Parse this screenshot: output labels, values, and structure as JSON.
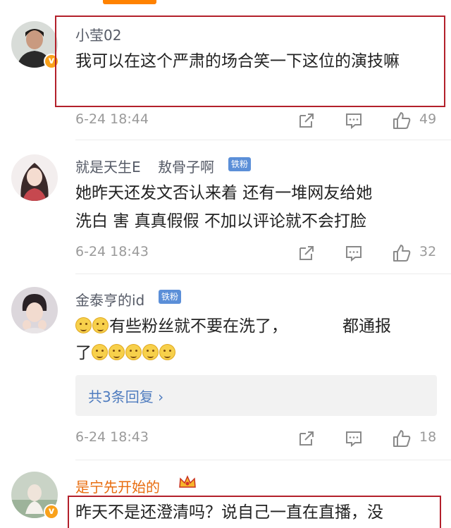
{
  "colors": {
    "accent": "#ff8200",
    "highlight_border": "#b3202b",
    "fan_badge": "#5b8fd8",
    "link": "#4f7cbf",
    "gold_name": "#e86c0e"
  },
  "comments": [
    {
      "username": "小莹02",
      "text": "我可以在这个严肃的场合笑一下这位的演技嘛",
      "time": "6-24 18:44",
      "likes": "49",
      "verified": true
    },
    {
      "username": "就是天生E",
      "username_tail": "敖骨子啊",
      "badge": "铁粉",
      "line1": "她昨天还发文否认来着 还有一堆网友给她",
      "line2": "洗白 害  真真假假 不加以评论就不会打脸",
      "time": "6-24 18:43",
      "likes": "32"
    },
    {
      "username": "金泰亨的id",
      "badge": "铁粉",
      "line1_text": "有些粉丝就不要在洗了，",
      "line1_tail": "都通报",
      "line2_text": "了",
      "replies": "共3条回复 ›",
      "time": "6-24 18:43",
      "likes": "18"
    },
    {
      "username": "是宁先开始的",
      "text": "昨天不是还澄清吗？说自己一直在直播，没",
      "verified": true
    }
  ],
  "icons": [
    "share-icon",
    "comment-icon",
    "like-icon",
    "verified-icon",
    "crown-icon",
    "emoji-icon"
  ]
}
